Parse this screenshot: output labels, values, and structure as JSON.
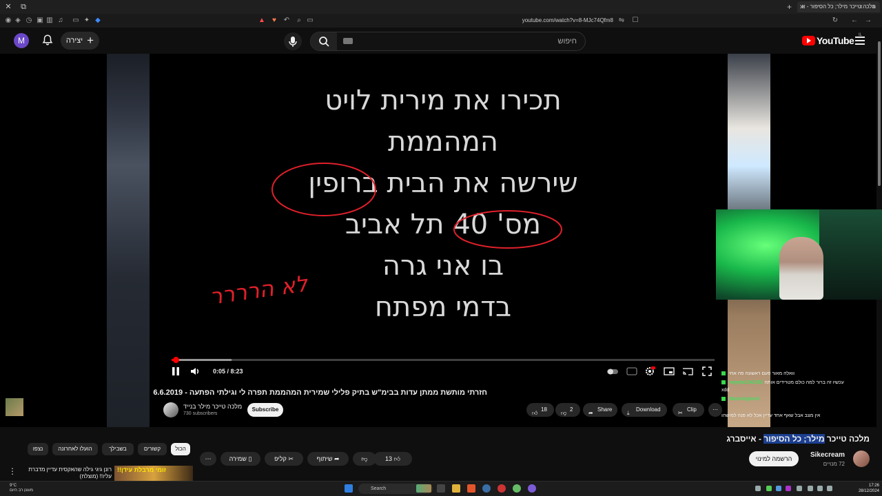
{
  "browser": {
    "tab_title": "מלכה טייכר מילר; כל הסיפור - א",
    "url": "youtube.com/watch?v=8-MJc74Qfm8"
  },
  "header": {
    "avatar_letter": "M",
    "create_label": "יצירה",
    "search_placeholder": "חיפוש",
    "logo_text": "YouTube",
    "logo_region": "IL"
  },
  "player": {
    "slide_lines": [
      "תכירו את מירית לויט",
      "המהממת",
      "שירשה את הבית ברופין",
      "מס' 40 תל אביב",
      "בו אני גרה",
      "בדמי מפתח"
    ],
    "handwritten_note": "לא הרררר",
    "time": "0:05 / 8:23",
    "progress_fraction": 0.006,
    "buffered_fraction": 0.11
  },
  "video_info": {
    "title": "חזרתי מותשת ממתן עדות בבימ\"ש בתיק פלילי שמירית המהממת תפרה לי וגילתי הפתעה - 6.6.2019",
    "channel_name": "מלכה טייכר מילר בנייד",
    "subscribers": "730 subscribers",
    "subscribe_label": "Subscribe",
    "likes": "18",
    "dislikes": "2",
    "share_label": "Share",
    "download_label": "Download",
    "clip_label": "Clip"
  },
  "chat": [
    {
      "user": "",
      "msg": "וואלה מאור פעם ראשונה פה אחי"
    },
    {
      "user": "vegeta1242352",
      "msg": "עכשיו זה ברור למה כולם מטרידים אותה"
    },
    {
      "user": "",
      "msg": "xdd"
    },
    {
      "user": "Washingtonit",
      "msg": ""
    },
    {
      "user": "",
      "msg": "אין מצב אבל שאף אחד עדיין אכל לא פנה למישהו"
    }
  ],
  "stream": {
    "title_prefix": "מלכה טייכר ",
    "title_highlight": "מילר; כל הסיפור",
    "title_suffix": " - אייסברג",
    "channel_name": "Sikecream",
    "channel_subs": "72 מנויים",
    "join_label": "הרשמה למינוי"
  },
  "actions": {
    "likes": "13",
    "share": "שיתוף",
    "clip": "קליפ",
    "save": "שמירה"
  },
  "chips": [
    "הכול",
    "קשורים",
    "בשבילך",
    "הועלו לאחרונה",
    "נצפו"
  ],
  "recommended": {
    "title": "רונן גיגי גילה שהאקסית עדיין מדברת עליו!! (מוצלח)",
    "thumb_text": "זומי מרבלת עידן!!"
  },
  "taskbar": {
    "weather_temp": "9°C",
    "weather_desc": "מעונן רב היום",
    "search_label": "Search",
    "time": "17:26",
    "date": "28/12/2024"
  },
  "colors": {
    "yt_red": "#ff0000",
    "accent_highlight": "#1c3f8f",
    "chat_user": "#4cd964",
    "annotation": "#e0202a"
  }
}
